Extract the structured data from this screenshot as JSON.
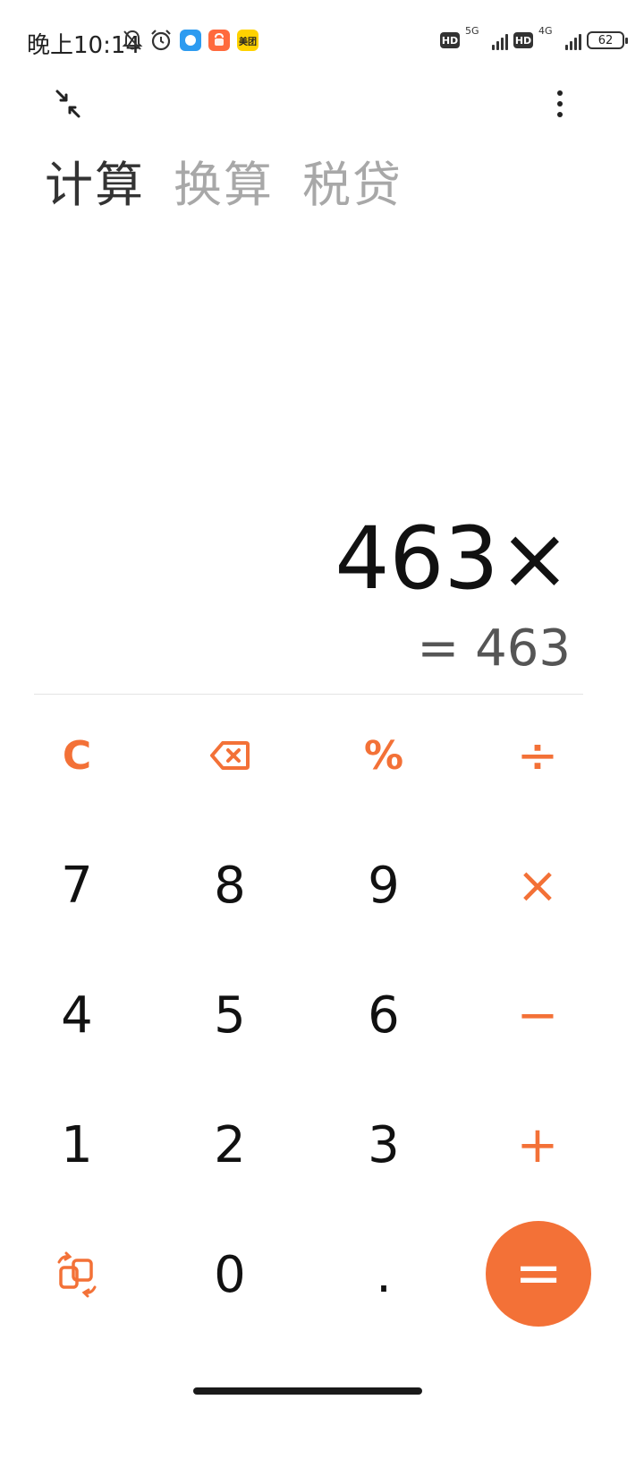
{
  "status_bar": {
    "time": "晚上10:14",
    "icons": [
      "bell-off-icon",
      "alarm-icon",
      "messenger-app-icon",
      "shopping-app-icon",
      "meituan-app-icon"
    ],
    "meituan_label": "美团",
    "network": [
      {
        "hd": "HD",
        "type": "5G",
        "signal_bars": 4
      },
      {
        "hd": "HD",
        "type": "4G",
        "signal_bars": 4
      }
    ],
    "battery": "62"
  },
  "header": {
    "shrink_icon": "shrink-arrows-icon",
    "menu_icon": "more-vertical-icon"
  },
  "tabs": [
    {
      "label": "计算",
      "active": true
    },
    {
      "label": "换算",
      "active": false
    },
    {
      "label": "税贷",
      "active": false
    }
  ],
  "display": {
    "expression": "463×",
    "result": "= 463"
  },
  "keypad": {
    "row1": [
      {
        "label": "C",
        "name": "clear"
      },
      {
        "label": "",
        "name": "backspace",
        "icon": "backspace-icon"
      },
      {
        "label": "%",
        "name": "percent"
      },
      {
        "label": "÷",
        "name": "divide"
      }
    ],
    "row2": [
      {
        "label": "7"
      },
      {
        "label": "8"
      },
      {
        "label": "9"
      },
      {
        "label": "×",
        "name": "multiply"
      }
    ],
    "row3": [
      {
        "label": "4"
      },
      {
        "label": "5"
      },
      {
        "label": "6"
      },
      {
        "label": "−",
        "name": "minus"
      }
    ],
    "row4": [
      {
        "label": "1"
      },
      {
        "label": "2"
      },
      {
        "label": "3"
      },
      {
        "label": "+",
        "name": "plus"
      }
    ],
    "row5": [
      {
        "label": "",
        "name": "switch-mode",
        "icon": "switch-mode-icon"
      },
      {
        "label": "0"
      },
      {
        "label": "."
      },
      {
        "label": "=",
        "name": "equals"
      }
    ]
  },
  "colors": {
    "accent": "#f37137",
    "text": "#111111",
    "inactive_tab": "#a8a8a8",
    "result_text": "#555555"
  }
}
